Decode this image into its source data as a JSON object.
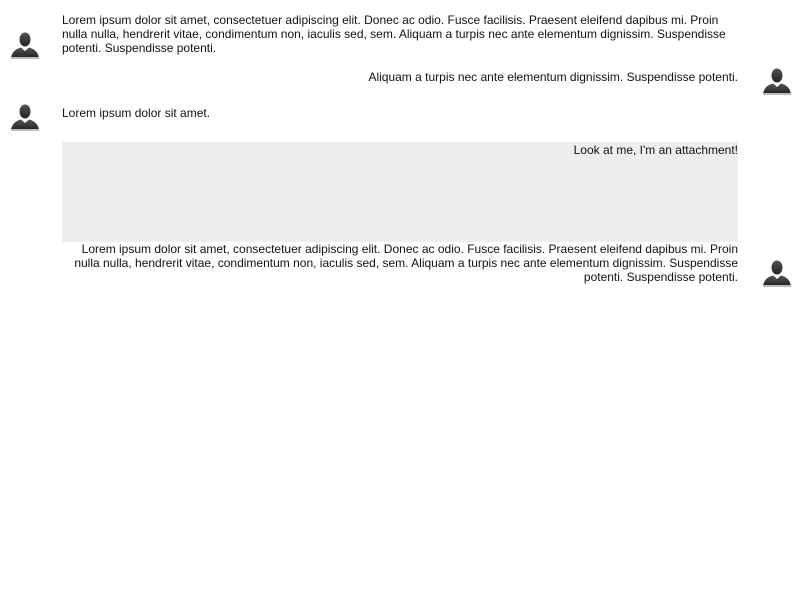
{
  "messages": [
    {
      "direction": "incoming",
      "text": "Lorem ipsum dolor sit amet, consectetuer adipiscing elit. Donec ac odio. Fusce facilisis. Praesent eleifend dapibus mi. Proin nulla nulla, hendrerit vitae, condimentum non, iaculis sed, sem. Aliquam a turpis nec ante elementum dignissim. Suspendisse potenti. Suspendisse potenti.",
      "avatar_icon": "user-silhouette-icon"
    },
    {
      "direction": "outgoing",
      "text": "Aliquam a turpis nec ante elementum dignissim. Suspendisse potenti.",
      "avatar_icon": "user-silhouette-icon"
    },
    {
      "direction": "incoming",
      "text": "Lorem ipsum dolor sit amet.",
      "avatar_icon": "user-silhouette-icon"
    },
    {
      "direction": "outgoing",
      "attachment_label": "Look at me, I'm an attachment!",
      "text": "Lorem ipsum dolor sit amet, consectetuer adipiscing elit. Donec ac odio. Fusce facilisis. Praesent eleifend dapibus mi. Proin nulla nulla, hendrerit vitae, condimentum non, iaculis sed, sem. Aliquam a turpis nec ante elementum dignissim. Suspendisse potenti. Suspendisse potenti.",
      "avatar_icon": "user-silhouette-icon"
    }
  ],
  "colors": {
    "text": "#111111",
    "attachment_background": "#eeeeee",
    "avatar": "#333333"
  }
}
